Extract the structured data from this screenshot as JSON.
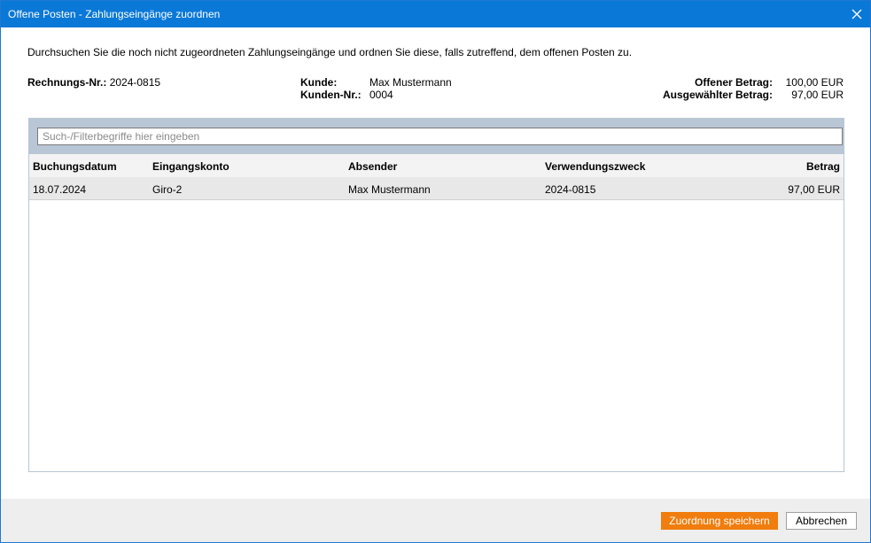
{
  "window": {
    "title": "Offene Posten - Zahlungseingänge zuordnen"
  },
  "intro": "Durchsuchen Sie die noch nicht zugeordneten Zahlungseingänge und ordnen Sie diese, falls zutreffend, dem offenen Posten zu.",
  "invoice": {
    "label": "Rechnungs-Nr.:",
    "value": "2024-0815"
  },
  "customer": {
    "name_label": "Kunde:",
    "name_value": "Max Mustermann",
    "number_label": "Kunden-Nr.:",
    "number_value": "0004"
  },
  "amounts": {
    "open_label": "Offener Betrag:",
    "open_value": "100,00 EUR",
    "selected_label": "Ausgewählter Betrag:",
    "selected_value": "97,00 EUR"
  },
  "filter": {
    "placeholder": "Such-/Filterbegriffe hier eingeben",
    "value": ""
  },
  "table": {
    "columns": [
      "Buchungsdatum",
      "Eingangskonto",
      "Absender",
      "Verwendungszweck",
      "Betrag"
    ],
    "rows": [
      [
        "18.07.2024",
        "Giro-2",
        "Max Mustermann",
        "2024-0815",
        "97,00 EUR"
      ]
    ]
  },
  "buttons": {
    "save": "Zuordnung speichern",
    "cancel": "Abbrechen"
  },
  "colors": {
    "titlebar": "#0a78d7",
    "accent_button": "#f07d0d",
    "filter_bar": "#b9c6d6",
    "selected_row": "#e8e8e8"
  }
}
